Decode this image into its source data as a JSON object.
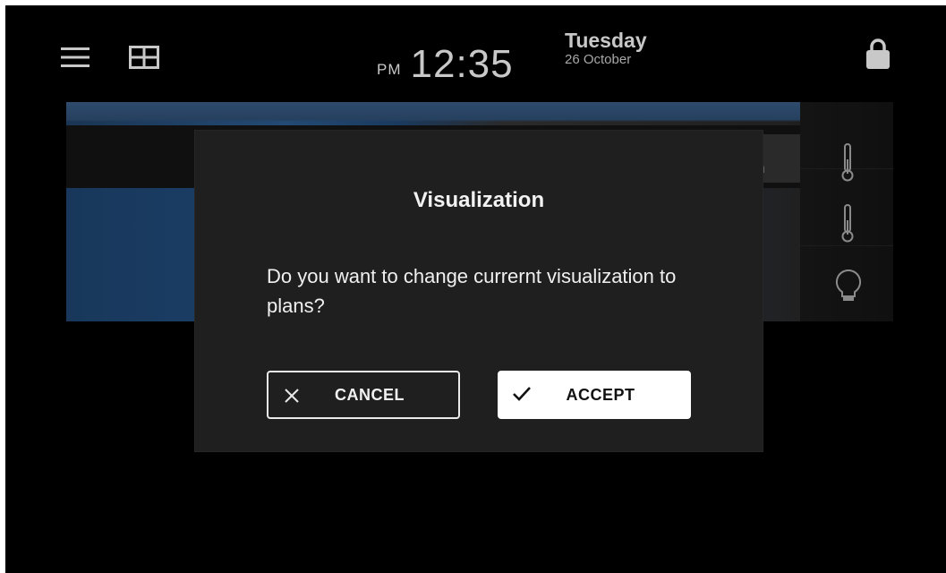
{
  "header": {
    "ampm": "PM",
    "time": "12:35",
    "day": "Tuesday",
    "date": "26 October",
    "menu_icon": "hamburger-menu-icon",
    "grid_icon": "grid-view-icon",
    "lock_icon": "lock-icon"
  },
  "background": {
    "partial_label": "n",
    "side_icons": [
      "thermometer-icon",
      "thermometer-icon",
      "lightbulb-icon"
    ]
  },
  "dialog": {
    "title": "Visualization",
    "message": "Do you want to change currernt visualization to plans?",
    "cancel_label": "CANCEL",
    "accept_label": "ACCEPT"
  },
  "colors": {
    "background": "#000000",
    "dialog": "#1f1f1f",
    "text": "#f2f2f2",
    "accent_button": "#ffffff"
  }
}
